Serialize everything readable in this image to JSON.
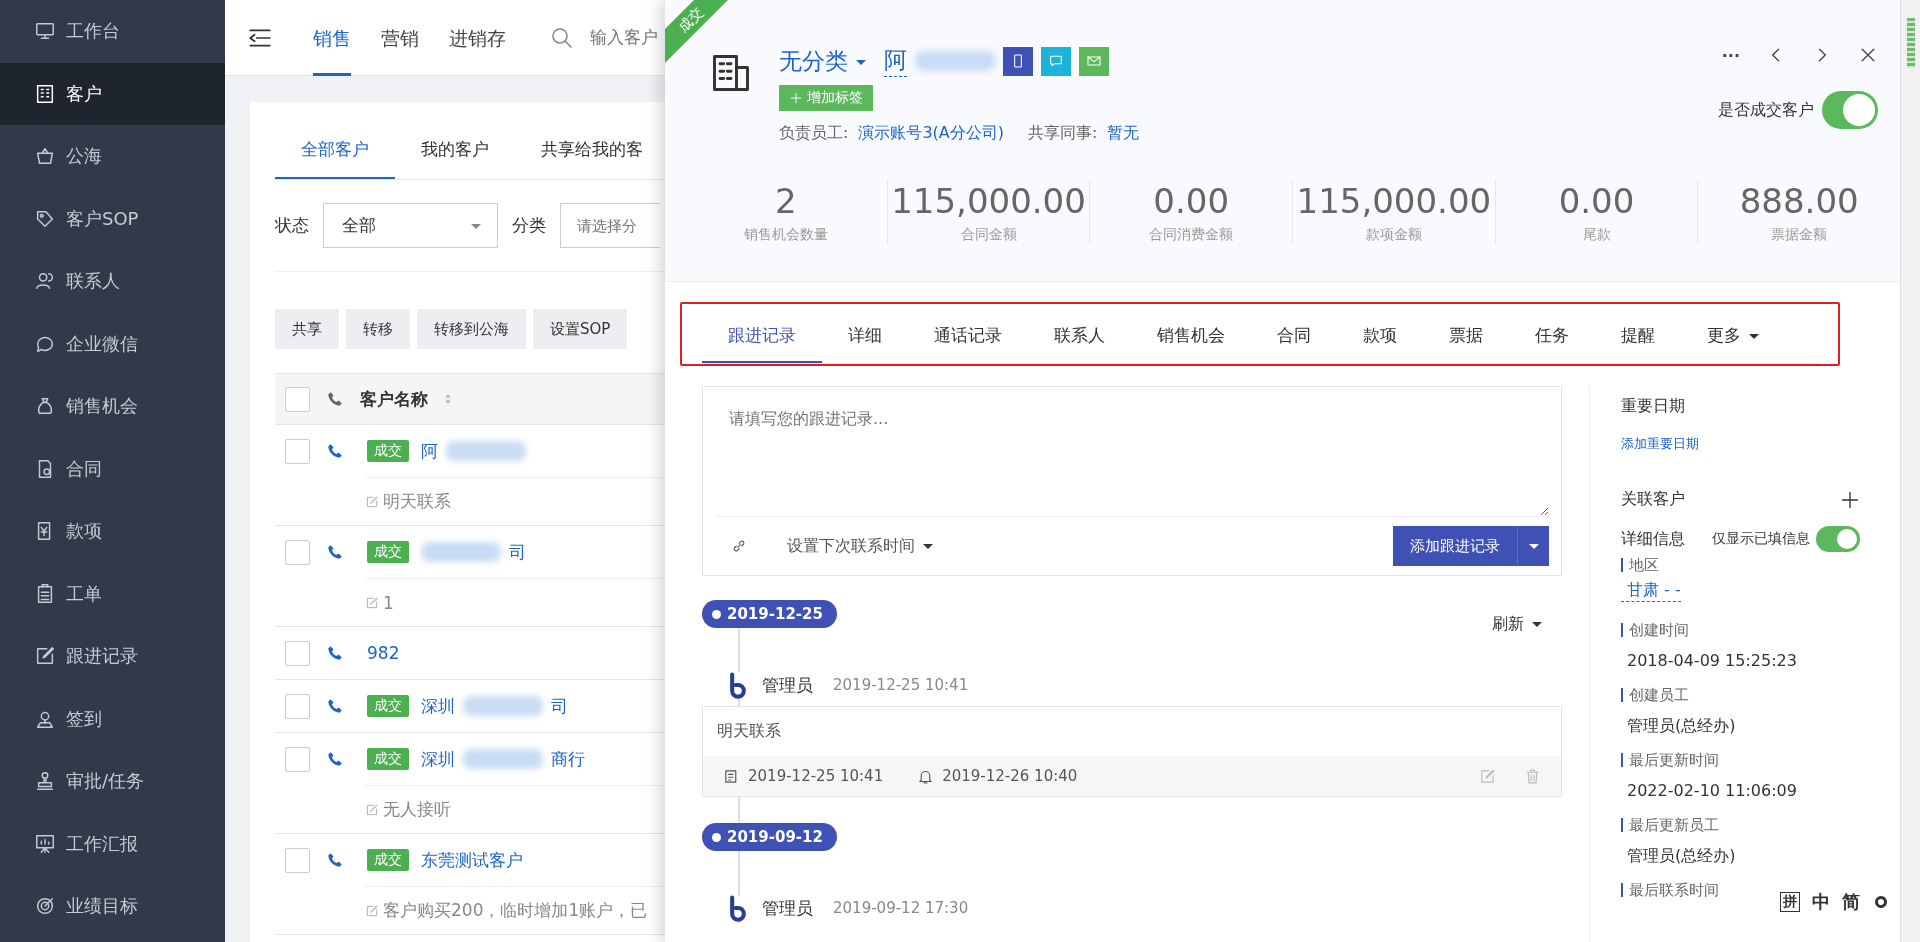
{
  "sidebar": {
    "items": [
      {
        "label": "工作台",
        "selected": false
      },
      {
        "label": "客户",
        "selected": true
      },
      {
        "label": "公海",
        "selected": false
      },
      {
        "label": "客户SOP",
        "selected": false
      },
      {
        "label": "联系人",
        "selected": false
      },
      {
        "label": "企业微信",
        "selected": false
      },
      {
        "label": "销售机会",
        "selected": false
      },
      {
        "label": "合同",
        "selected": false
      },
      {
        "label": "款项",
        "selected": false
      },
      {
        "label": "工单",
        "selected": false
      },
      {
        "label": "跟进记录",
        "selected": false
      },
      {
        "label": "签到",
        "selected": false
      },
      {
        "label": "审批/任务",
        "selected": false
      },
      {
        "label": "工作汇报",
        "selected": false
      },
      {
        "label": "业绩目标",
        "selected": false
      }
    ]
  },
  "top_nav": {
    "tabs": [
      {
        "label": "销售",
        "selected": true
      },
      {
        "label": "营销",
        "selected": false
      },
      {
        "label": "进销存",
        "selected": false
      }
    ],
    "search": {
      "placeholder": "输入客户"
    }
  },
  "customer_list": {
    "tabs": [
      {
        "label": "全部客户",
        "selected": true
      },
      {
        "label": "我的客户",
        "selected": false
      },
      {
        "label": "共享给我的客",
        "selected": false
      }
    ],
    "filters": [
      {
        "label": "状态",
        "value": "全部",
        "kind": "select"
      },
      {
        "label": "分类",
        "placeholder": "请选择分",
        "kind": "input"
      }
    ],
    "actions": [
      "共享",
      "转移",
      "转移到公海",
      "设置SOP"
    ],
    "header": {
      "name": "客户名称",
      "checked": false
    },
    "rows": [
      {
        "tag": "成交",
        "name_start": "阿",
        "blurred": true,
        "checked": false,
        "note": "明天联系"
      },
      {
        "tag": "成交",
        "name_end": "司",
        "blurred": true,
        "checked": false,
        "note": "1"
      },
      {
        "name_start": "982",
        "blurred": false,
        "checked": false
      },
      {
        "tag": "成交",
        "name_start": "深圳",
        "name_end": "司",
        "blurred": true,
        "checked": false
      },
      {
        "tag": "成交",
        "name_start": "深圳",
        "name_end": "商行",
        "blurred": true,
        "checked": false,
        "note": "无人接听"
      },
      {
        "tag": "成交",
        "name_start": "东莞测试客户",
        "blurred": false,
        "checked": false,
        "note": "客户购买200，临时增加1账户，已"
      }
    ]
  },
  "drawer": {
    "ribbon": "成交",
    "category": "无分类",
    "name": "阿",
    "name_blurred": true,
    "add_tag": "增加标签",
    "owner": {
      "label": "负责员工:",
      "value": "演示账号3(A分公司)"
    },
    "shared": {
      "label": "共享同事:",
      "value": "暂无"
    },
    "more": "···",
    "deal_switch": {
      "label": "是否成交客户",
      "on": true
    },
    "stats": [
      {
        "value": "2",
        "label": "销售机会数量"
      },
      {
        "value": "115,000.00",
        "label": "合同金额"
      },
      {
        "value": "0.00",
        "label": "合同消费金额"
      },
      {
        "value": "115,000.00",
        "label": "款项金额"
      },
      {
        "value": "0.00",
        "label": "尾款"
      },
      {
        "value": "888.00",
        "label": "票据金额"
      }
    ],
    "tabs": [
      {
        "label": "跟进记录",
        "selected": true
      },
      {
        "label": "详细",
        "selected": false
      },
      {
        "label": "通话记录",
        "selected": false
      },
      {
        "label": "联系人",
        "selected": false
      },
      {
        "label": "销售机会",
        "selected": false
      },
      {
        "label": "合同",
        "selected": false
      },
      {
        "label": "款项",
        "selected": false
      },
      {
        "label": "票据",
        "selected": false
      },
      {
        "label": "任务",
        "selected": false
      },
      {
        "label": "提醒",
        "selected": false
      },
      {
        "label": "更多",
        "selected": false,
        "dropdown": true
      }
    ],
    "editor": {
      "placeholder": "请填写您的跟进记录...",
      "next_contact": "设置下次联系时间",
      "submit": "添加跟进记录"
    },
    "refresh": "刷新",
    "timeline": [
      {
        "date": "2019-12-25",
        "entries": [
          {
            "author": "管理员",
            "time": "2019-12-25 10:41",
            "content": "明天联系",
            "created": "2019-12-25 10:41",
            "remind": "2019-12-26 10:40"
          }
        ]
      },
      {
        "date": "2019-09-12",
        "entries": [
          {
            "author": "管理员",
            "time": "2019-09-12 17:30"
          }
        ]
      }
    ],
    "side": {
      "important_dates": "重要日期",
      "add_date": "添加重要日期",
      "related": "关联客户",
      "details": "详细信息",
      "filled_only": {
        "label": "仅显示已填信息",
        "on": true
      },
      "fields": [
        {
          "label": "地区",
          "value": "甘肃 - -",
          "kind": "link"
        },
        {
          "label": "创建时间",
          "value": "2018-04-09 15:25:23"
        },
        {
          "label": "创建员工",
          "value": "管理员(总经办)"
        },
        {
          "label": "最后更新时间",
          "value": "2022-02-10 11:06:09"
        },
        {
          "label": "最后更新员工",
          "value": "管理员(总经办)"
        },
        {
          "label": "最后联系时间"
        }
      ]
    }
  },
  "ime_bar": {
    "items": [
      "拼",
      "中",
      "简"
    ]
  }
}
